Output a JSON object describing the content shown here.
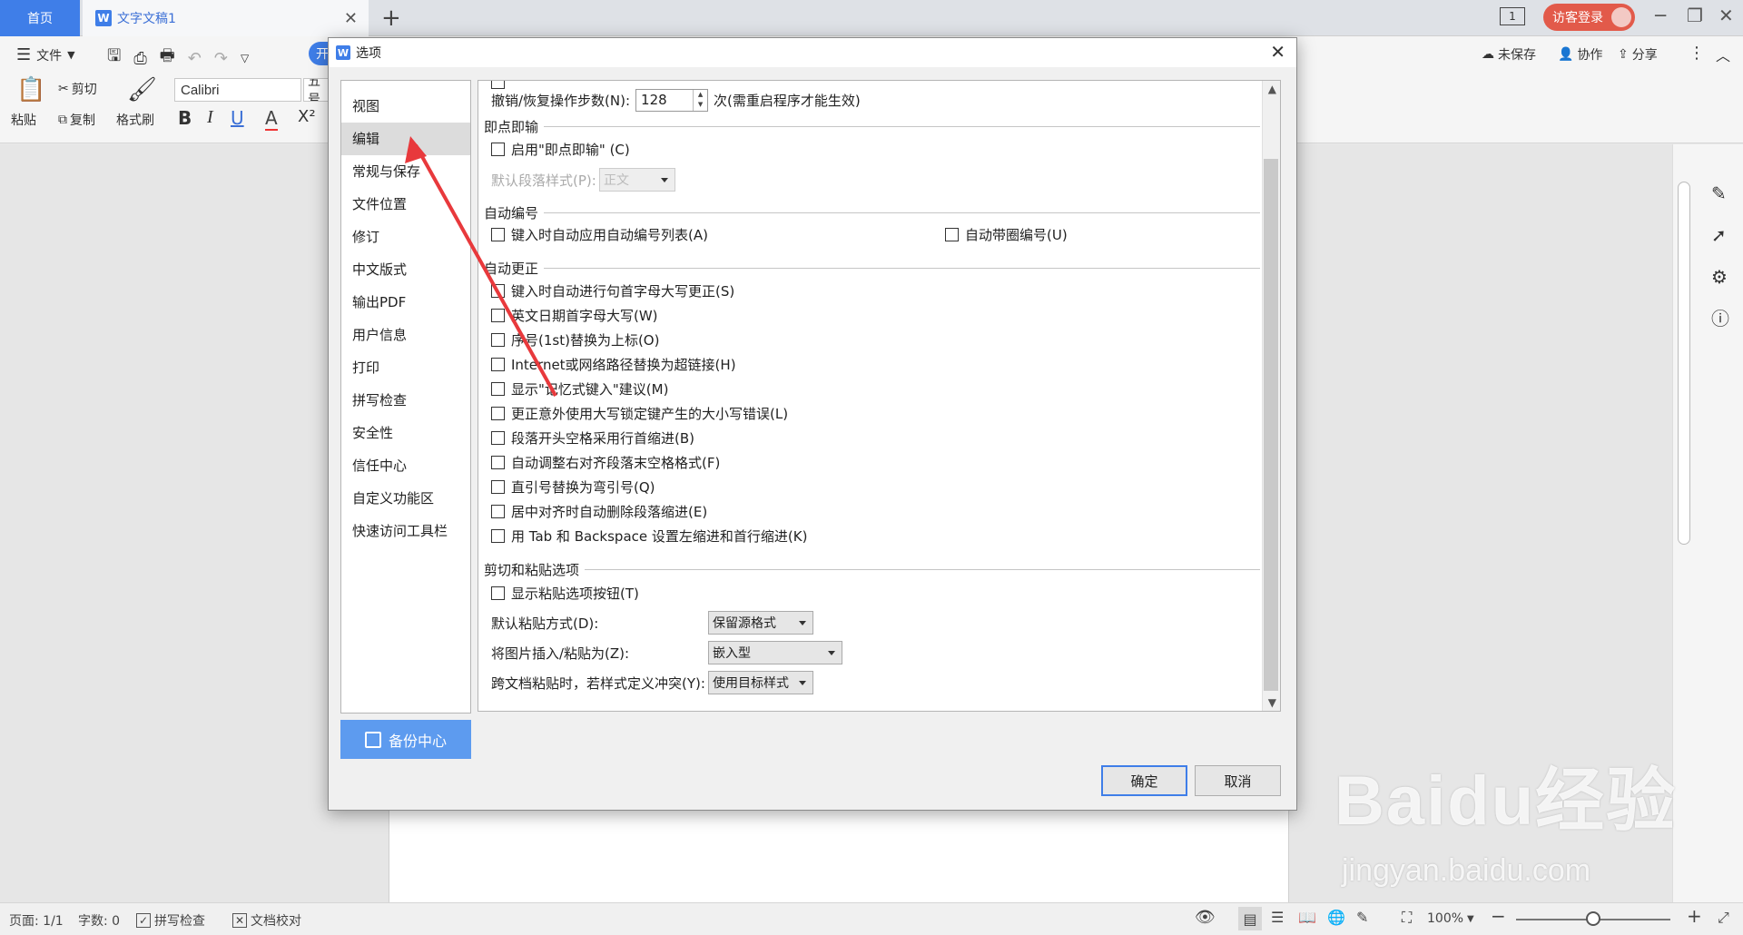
{
  "tabs": {
    "home": "首页",
    "doc": "文字文稿1",
    "close": "✕",
    "add": "+"
  },
  "titlebar": {
    "page_badge": "1",
    "login": "访客登录"
  },
  "menubar": {
    "file": "文件",
    "open": "开",
    "unsaved": "未保存",
    "collab": "协作",
    "share": "分享"
  },
  "ribbon": {
    "paste": "粘贴",
    "cut": "剪切",
    "copy": "复制",
    "format_painter": "格式刷",
    "font": "Calibri",
    "font_size": "五号",
    "bold": "B",
    "italic": "I",
    "underline": "U",
    "font_color": "A",
    "superscript": "X²"
  },
  "dialog": {
    "title": "选项",
    "close": "✕",
    "nav": [
      "视图",
      "编辑",
      "常规与保存",
      "文件位置",
      "修订",
      "中文版式",
      "输出PDF",
      "用户信息",
      "打印",
      "拼写检查",
      "安全性",
      "信任中心",
      "自定义功能区",
      "快速访问工具栏"
    ],
    "backup": "备份中心",
    "undo_label": "撤销/恢复操作步数(N):",
    "undo_value": "128",
    "undo_suffix": "次(需重启程序才能生效)",
    "sections": {
      "click_type": "即点即输",
      "auto_number": "自动编号",
      "auto_correct": "自动更正",
      "cut_paste": "剪切和粘贴选项"
    },
    "click_type_enable": "启用\"即点即输\" (C)",
    "default_para_label": "默认段落样式(P):",
    "default_para_value": "正文",
    "auto_number_list": "键入时自动应用自动编号列表(A)",
    "auto_circle_number": "自动带圈编号(U)",
    "autocorrect_items": [
      "键入时自动进行句首字母大写更正(S)",
      "英文日期首字母大写(W)",
      "序号(1st)替换为上标(O)",
      "Internet或网络路径替换为超链接(H)",
      "显示\"记忆式键入\"建议(M)",
      "更正意外使用大写锁定键产生的大小写错误(L)",
      "段落开头空格采用行首缩进(B)",
      "自动调整右对齐段落末空格格式(F)",
      "直引号替换为弯引号(Q)",
      "居中对齐时自动删除段落缩进(E)",
      "用 Tab 和 Backspace 设置左缩进和首行缩进(K)"
    ],
    "show_paste_btn": "显示粘贴选项按钮(T)",
    "default_paste_label": "默认粘贴方式(D):",
    "default_paste_value": "保留源格式",
    "image_paste_label": "将图片插入/粘贴为(Z):",
    "image_paste_value": "嵌入型",
    "cross_doc_label": "跨文档粘贴时，若样式定义冲突(Y):",
    "cross_doc_value": "使用目标样式",
    "ok": "确定",
    "cancel": "取消"
  },
  "statusbar": {
    "page": "页面: 1/1",
    "words": "字数: 0",
    "spell": "拼写检查",
    "proof": "文档校对",
    "zoom": "100%"
  },
  "watermark": {
    "main": "Baidu经验",
    "sub": "jingyan.baidu.com"
  },
  "colors": {
    "accent": "#3f7ee8",
    "arrow": "#e8393c",
    "login": "#e25a4a"
  }
}
